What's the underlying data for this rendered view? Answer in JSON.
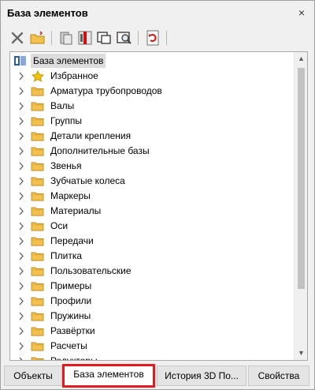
{
  "window": {
    "title": "База элементов",
    "close_glyph": "×"
  },
  "toolbar": {
    "buttons": [
      {
        "name": "delete-icon",
        "color": "#606060"
      },
      {
        "name": "open-folder-icon",
        "color": "#e6b422"
      },
      {
        "name": "properties-icon",
        "color": "#808080"
      },
      {
        "name": "library-tool-icon",
        "color": "#d01010"
      },
      {
        "name": "insert-view-icon",
        "color": "#404040"
      },
      {
        "name": "search-preview-icon",
        "color": "#404040"
      },
      {
        "name": "refresh-icon",
        "color": "#d01010"
      }
    ]
  },
  "tree": {
    "root_label": "База элементов",
    "items": [
      {
        "label": "Избранное",
        "icon": "star-icon"
      },
      {
        "label": "Арматура трубопроводов",
        "icon": "folder-icon"
      },
      {
        "label": "Валы",
        "icon": "folder-icon"
      },
      {
        "label": "Группы",
        "icon": "folder-icon"
      },
      {
        "label": "Детали крепления",
        "icon": "folder-icon"
      },
      {
        "label": "Дополнительные базы",
        "icon": "folder-icon"
      },
      {
        "label": "Звенья",
        "icon": "folder-icon"
      },
      {
        "label": "Зубчатые колеса",
        "icon": "folder-icon"
      },
      {
        "label": "Маркеры",
        "icon": "folder-icon"
      },
      {
        "label": "Материалы",
        "icon": "folder-icon"
      },
      {
        "label": "Оси",
        "icon": "folder-icon"
      },
      {
        "label": "Передачи",
        "icon": "folder-icon"
      },
      {
        "label": "Плитка",
        "icon": "folder-icon"
      },
      {
        "label": "Пользовательские",
        "icon": "folder-icon"
      },
      {
        "label": "Примеры",
        "icon": "folder-icon"
      },
      {
        "label": "Профили",
        "icon": "folder-icon"
      },
      {
        "label": "Пружины",
        "icon": "folder-icon"
      },
      {
        "label": "Развёртки",
        "icon": "folder-icon"
      },
      {
        "label": "Расчеты",
        "icon": "folder-icon"
      },
      {
        "label": "Редукторы",
        "icon": "folder-icon"
      }
    ]
  },
  "tabs": [
    {
      "label": "Объекты",
      "active": false
    },
    {
      "label": "База элементов",
      "active": true
    },
    {
      "label": "История 3D По...",
      "active": false
    },
    {
      "label": "Свойства",
      "active": false
    }
  ],
  "colors": {
    "active_tab_border": "#e01b24",
    "folder": "#f2c14e",
    "star": "#f5c400"
  }
}
